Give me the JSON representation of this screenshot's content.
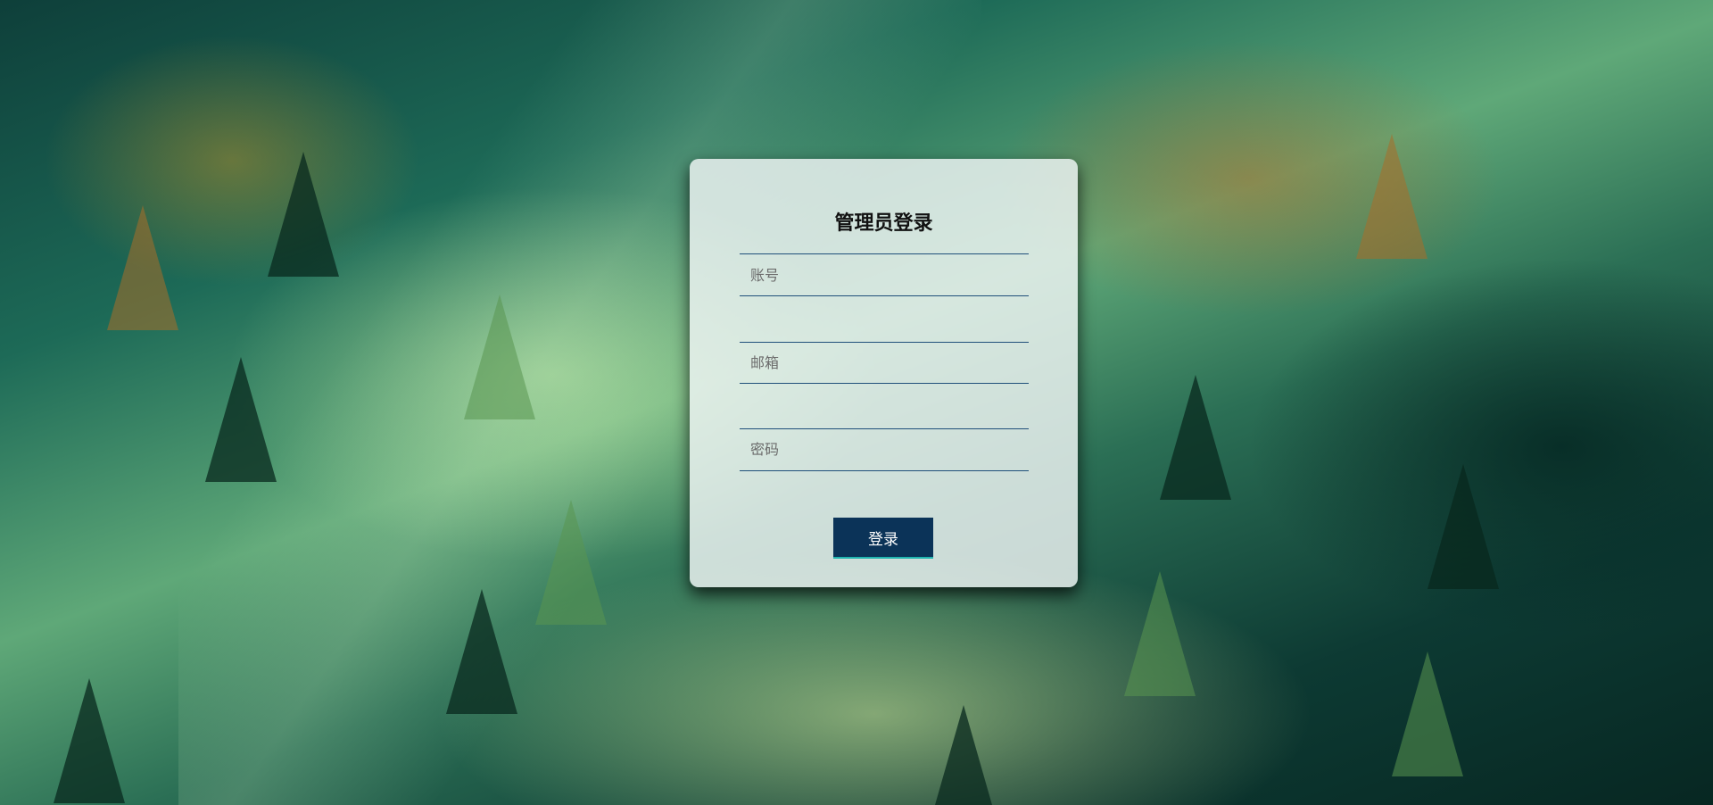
{
  "login": {
    "title": "管理员登录",
    "account_placeholder": "账号",
    "email_placeholder": "邮箱",
    "password_placeholder": "密码",
    "submit_label": "登录"
  },
  "colors": {
    "button_bg": "#0b3358",
    "button_accent": "#1fb5b0",
    "field_underline": "#1f4f7a",
    "card_bg": "rgba(240,245,245,0.82)"
  }
}
